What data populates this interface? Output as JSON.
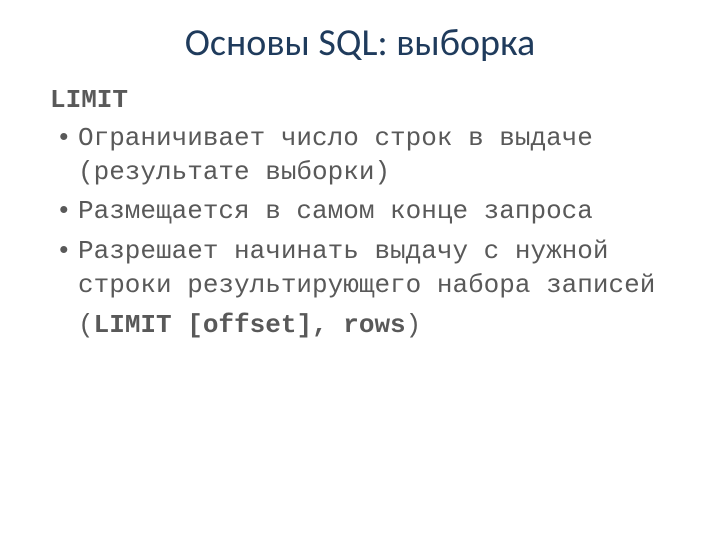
{
  "title": "Основы SQL: выборка",
  "keyword": "LIMIT",
  "bullets": [
    "Ограничивает число строк в выдаче (результате выборки)",
    "Размещается в самом конце запроса",
    "Разрешает начинать выдачу с нужной строки результирующего набора записей"
  ],
  "syntax": {
    "open": "(",
    "bold": "LIMIT [offset], rows",
    "close": ")"
  }
}
